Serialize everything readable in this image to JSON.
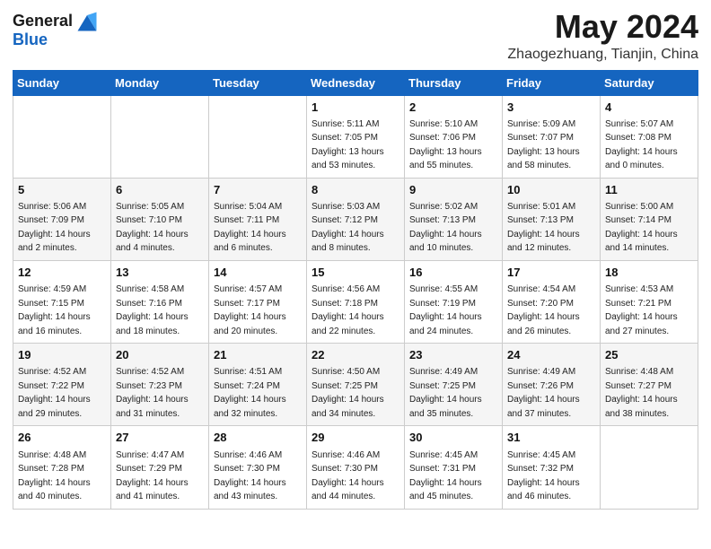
{
  "header": {
    "logo_general": "General",
    "logo_blue": "Blue",
    "month_year": "May 2024",
    "location": "Zhaogezhuang, Tianjin, China"
  },
  "weekdays": [
    "Sunday",
    "Monday",
    "Tuesday",
    "Wednesday",
    "Thursday",
    "Friday",
    "Saturday"
  ],
  "weeks": [
    [
      {
        "num": "",
        "sunrise": "",
        "sunset": "",
        "daylight": ""
      },
      {
        "num": "",
        "sunrise": "",
        "sunset": "",
        "daylight": ""
      },
      {
        "num": "",
        "sunrise": "",
        "sunset": "",
        "daylight": ""
      },
      {
        "num": "1",
        "sunrise": "Sunrise: 5:11 AM",
        "sunset": "Sunset: 7:05 PM",
        "daylight": "Daylight: 13 hours and 53 minutes."
      },
      {
        "num": "2",
        "sunrise": "Sunrise: 5:10 AM",
        "sunset": "Sunset: 7:06 PM",
        "daylight": "Daylight: 13 hours and 55 minutes."
      },
      {
        "num": "3",
        "sunrise": "Sunrise: 5:09 AM",
        "sunset": "Sunset: 7:07 PM",
        "daylight": "Daylight: 13 hours and 58 minutes."
      },
      {
        "num": "4",
        "sunrise": "Sunrise: 5:07 AM",
        "sunset": "Sunset: 7:08 PM",
        "daylight": "Daylight: 14 hours and 0 minutes."
      }
    ],
    [
      {
        "num": "5",
        "sunrise": "Sunrise: 5:06 AM",
        "sunset": "Sunset: 7:09 PM",
        "daylight": "Daylight: 14 hours and 2 minutes."
      },
      {
        "num": "6",
        "sunrise": "Sunrise: 5:05 AM",
        "sunset": "Sunset: 7:10 PM",
        "daylight": "Daylight: 14 hours and 4 minutes."
      },
      {
        "num": "7",
        "sunrise": "Sunrise: 5:04 AM",
        "sunset": "Sunset: 7:11 PM",
        "daylight": "Daylight: 14 hours and 6 minutes."
      },
      {
        "num": "8",
        "sunrise": "Sunrise: 5:03 AM",
        "sunset": "Sunset: 7:12 PM",
        "daylight": "Daylight: 14 hours and 8 minutes."
      },
      {
        "num": "9",
        "sunrise": "Sunrise: 5:02 AM",
        "sunset": "Sunset: 7:13 PM",
        "daylight": "Daylight: 14 hours and 10 minutes."
      },
      {
        "num": "10",
        "sunrise": "Sunrise: 5:01 AM",
        "sunset": "Sunset: 7:13 PM",
        "daylight": "Daylight: 14 hours and 12 minutes."
      },
      {
        "num": "11",
        "sunrise": "Sunrise: 5:00 AM",
        "sunset": "Sunset: 7:14 PM",
        "daylight": "Daylight: 14 hours and 14 minutes."
      }
    ],
    [
      {
        "num": "12",
        "sunrise": "Sunrise: 4:59 AM",
        "sunset": "Sunset: 7:15 PM",
        "daylight": "Daylight: 14 hours and 16 minutes."
      },
      {
        "num": "13",
        "sunrise": "Sunrise: 4:58 AM",
        "sunset": "Sunset: 7:16 PM",
        "daylight": "Daylight: 14 hours and 18 minutes."
      },
      {
        "num": "14",
        "sunrise": "Sunrise: 4:57 AM",
        "sunset": "Sunset: 7:17 PM",
        "daylight": "Daylight: 14 hours and 20 minutes."
      },
      {
        "num": "15",
        "sunrise": "Sunrise: 4:56 AM",
        "sunset": "Sunset: 7:18 PM",
        "daylight": "Daylight: 14 hours and 22 minutes."
      },
      {
        "num": "16",
        "sunrise": "Sunrise: 4:55 AM",
        "sunset": "Sunset: 7:19 PM",
        "daylight": "Daylight: 14 hours and 24 minutes."
      },
      {
        "num": "17",
        "sunrise": "Sunrise: 4:54 AM",
        "sunset": "Sunset: 7:20 PM",
        "daylight": "Daylight: 14 hours and 26 minutes."
      },
      {
        "num": "18",
        "sunrise": "Sunrise: 4:53 AM",
        "sunset": "Sunset: 7:21 PM",
        "daylight": "Daylight: 14 hours and 27 minutes."
      }
    ],
    [
      {
        "num": "19",
        "sunrise": "Sunrise: 4:52 AM",
        "sunset": "Sunset: 7:22 PM",
        "daylight": "Daylight: 14 hours and 29 minutes."
      },
      {
        "num": "20",
        "sunrise": "Sunrise: 4:52 AM",
        "sunset": "Sunset: 7:23 PM",
        "daylight": "Daylight: 14 hours and 31 minutes."
      },
      {
        "num": "21",
        "sunrise": "Sunrise: 4:51 AM",
        "sunset": "Sunset: 7:24 PM",
        "daylight": "Daylight: 14 hours and 32 minutes."
      },
      {
        "num": "22",
        "sunrise": "Sunrise: 4:50 AM",
        "sunset": "Sunset: 7:25 PM",
        "daylight": "Daylight: 14 hours and 34 minutes."
      },
      {
        "num": "23",
        "sunrise": "Sunrise: 4:49 AM",
        "sunset": "Sunset: 7:25 PM",
        "daylight": "Daylight: 14 hours and 35 minutes."
      },
      {
        "num": "24",
        "sunrise": "Sunrise: 4:49 AM",
        "sunset": "Sunset: 7:26 PM",
        "daylight": "Daylight: 14 hours and 37 minutes."
      },
      {
        "num": "25",
        "sunrise": "Sunrise: 4:48 AM",
        "sunset": "Sunset: 7:27 PM",
        "daylight": "Daylight: 14 hours and 38 minutes."
      }
    ],
    [
      {
        "num": "26",
        "sunrise": "Sunrise: 4:48 AM",
        "sunset": "Sunset: 7:28 PM",
        "daylight": "Daylight: 14 hours and 40 minutes."
      },
      {
        "num": "27",
        "sunrise": "Sunrise: 4:47 AM",
        "sunset": "Sunset: 7:29 PM",
        "daylight": "Daylight: 14 hours and 41 minutes."
      },
      {
        "num": "28",
        "sunrise": "Sunrise: 4:46 AM",
        "sunset": "Sunset: 7:30 PM",
        "daylight": "Daylight: 14 hours and 43 minutes."
      },
      {
        "num": "29",
        "sunrise": "Sunrise: 4:46 AM",
        "sunset": "Sunset: 7:30 PM",
        "daylight": "Daylight: 14 hours and 44 minutes."
      },
      {
        "num": "30",
        "sunrise": "Sunrise: 4:45 AM",
        "sunset": "Sunset: 7:31 PM",
        "daylight": "Daylight: 14 hours and 45 minutes."
      },
      {
        "num": "31",
        "sunrise": "Sunrise: 4:45 AM",
        "sunset": "Sunset: 7:32 PM",
        "daylight": "Daylight: 14 hours and 46 minutes."
      },
      {
        "num": "",
        "sunrise": "",
        "sunset": "",
        "daylight": ""
      }
    ]
  ]
}
